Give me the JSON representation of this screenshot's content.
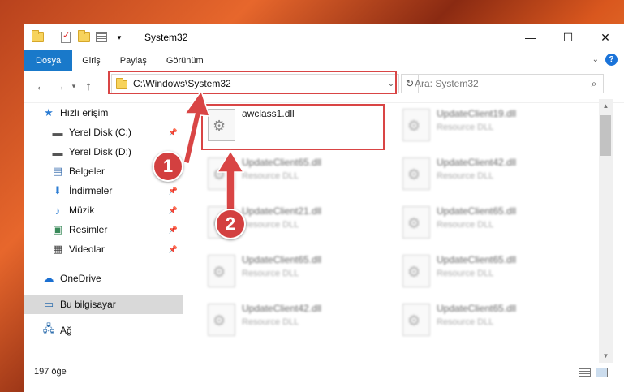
{
  "window": {
    "title": "System32",
    "caption": {
      "minimize": "—",
      "maximize": "☐",
      "close": "✕"
    }
  },
  "ribbon": {
    "tabs": [
      "Dosya",
      "Giriş",
      "Paylaş",
      "Görünüm"
    ]
  },
  "address": {
    "path": "C:\\Windows\\System32"
  },
  "search": {
    "placeholder": "Ara: System32"
  },
  "sidebar": {
    "items": [
      {
        "label": "Hızlı erişim",
        "icon": "star-icon"
      },
      {
        "label": "Yerel Disk (C:)",
        "icon": "drive-icon",
        "pinned": true
      },
      {
        "label": "Yerel Disk (D:)",
        "icon": "drive-icon",
        "pinned": false
      },
      {
        "label": "Belgeler",
        "icon": "document-icon",
        "pinned": true
      },
      {
        "label": "İndirmeler",
        "icon": "download-icon",
        "pinned": true
      },
      {
        "label": "Müzik",
        "icon": "music-icon",
        "pinned": true
      },
      {
        "label": "Resimler",
        "icon": "pictures-icon",
        "pinned": true
      },
      {
        "label": "Videolar",
        "icon": "video-icon",
        "pinned": true
      },
      {
        "label": "OneDrive",
        "icon": "cloud-icon"
      },
      {
        "label": "Bu bilgisayar",
        "icon": "computer-icon",
        "selected": true
      },
      {
        "label": "Ağ",
        "icon": "network-icon"
      }
    ]
  },
  "files": [
    {
      "name": "awclass1.dll",
      "type": ""
    },
    {
      "name": "UpdateClient19.dll",
      "type": "Resource DLL"
    },
    {
      "name": "UpdateClient65.dll",
      "type": "Resource DLL"
    },
    {
      "name": "UpdateClient42.dll",
      "type": "Resource DLL"
    },
    {
      "name": "UpdateClient21.dll",
      "type": "Resource DLL"
    },
    {
      "name": "UpdateClient65.dll",
      "type": "Resource DLL"
    },
    {
      "name": "UpdateClient65.dll",
      "type": "Resource DLL"
    },
    {
      "name": "UpdateClient65.dll",
      "type": "Resource DLL"
    },
    {
      "name": "UpdateClient42.dll",
      "type": "Resource DLL"
    },
    {
      "name": "UpdateClient65.dll",
      "type": "Resource DLL"
    }
  ],
  "status": {
    "count": "197 öğe"
  },
  "annotations": {
    "step1": "1",
    "step2": "2",
    "color": "#d94545"
  }
}
